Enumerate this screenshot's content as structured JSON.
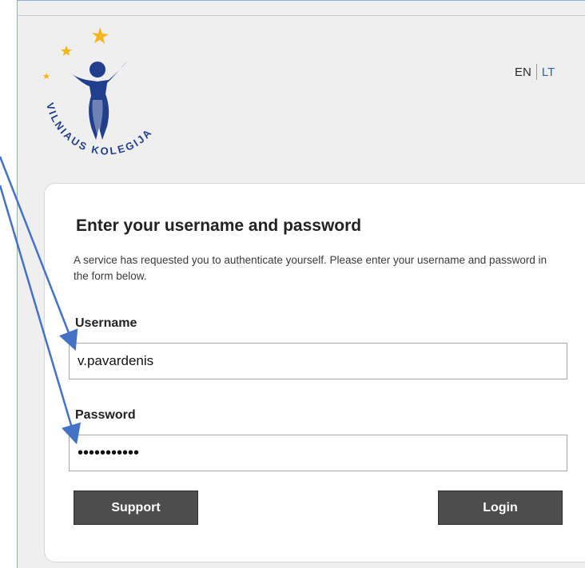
{
  "logo": {
    "text": "VILNIAUS KOLEGIJA",
    "icon": "vilniaus-kolegija-logo"
  },
  "language": {
    "en": "EN",
    "lt": "LT"
  },
  "login": {
    "heading": "Enter your username and password",
    "description": "A service has requested you to authenticate yourself. Please enter your username and password in the form below.",
    "username_label": "Username",
    "username_value": "v.pavardenis",
    "password_label": "Password",
    "password_value": "•••••••••••",
    "support_button": "Support",
    "login_button": "Login"
  },
  "colors": {
    "accent": "#2a63b8",
    "arrow": "#4472c4",
    "button": "#4d4d4d",
    "logo_blue": "#213f8c",
    "logo_star": "#f5b51b"
  }
}
